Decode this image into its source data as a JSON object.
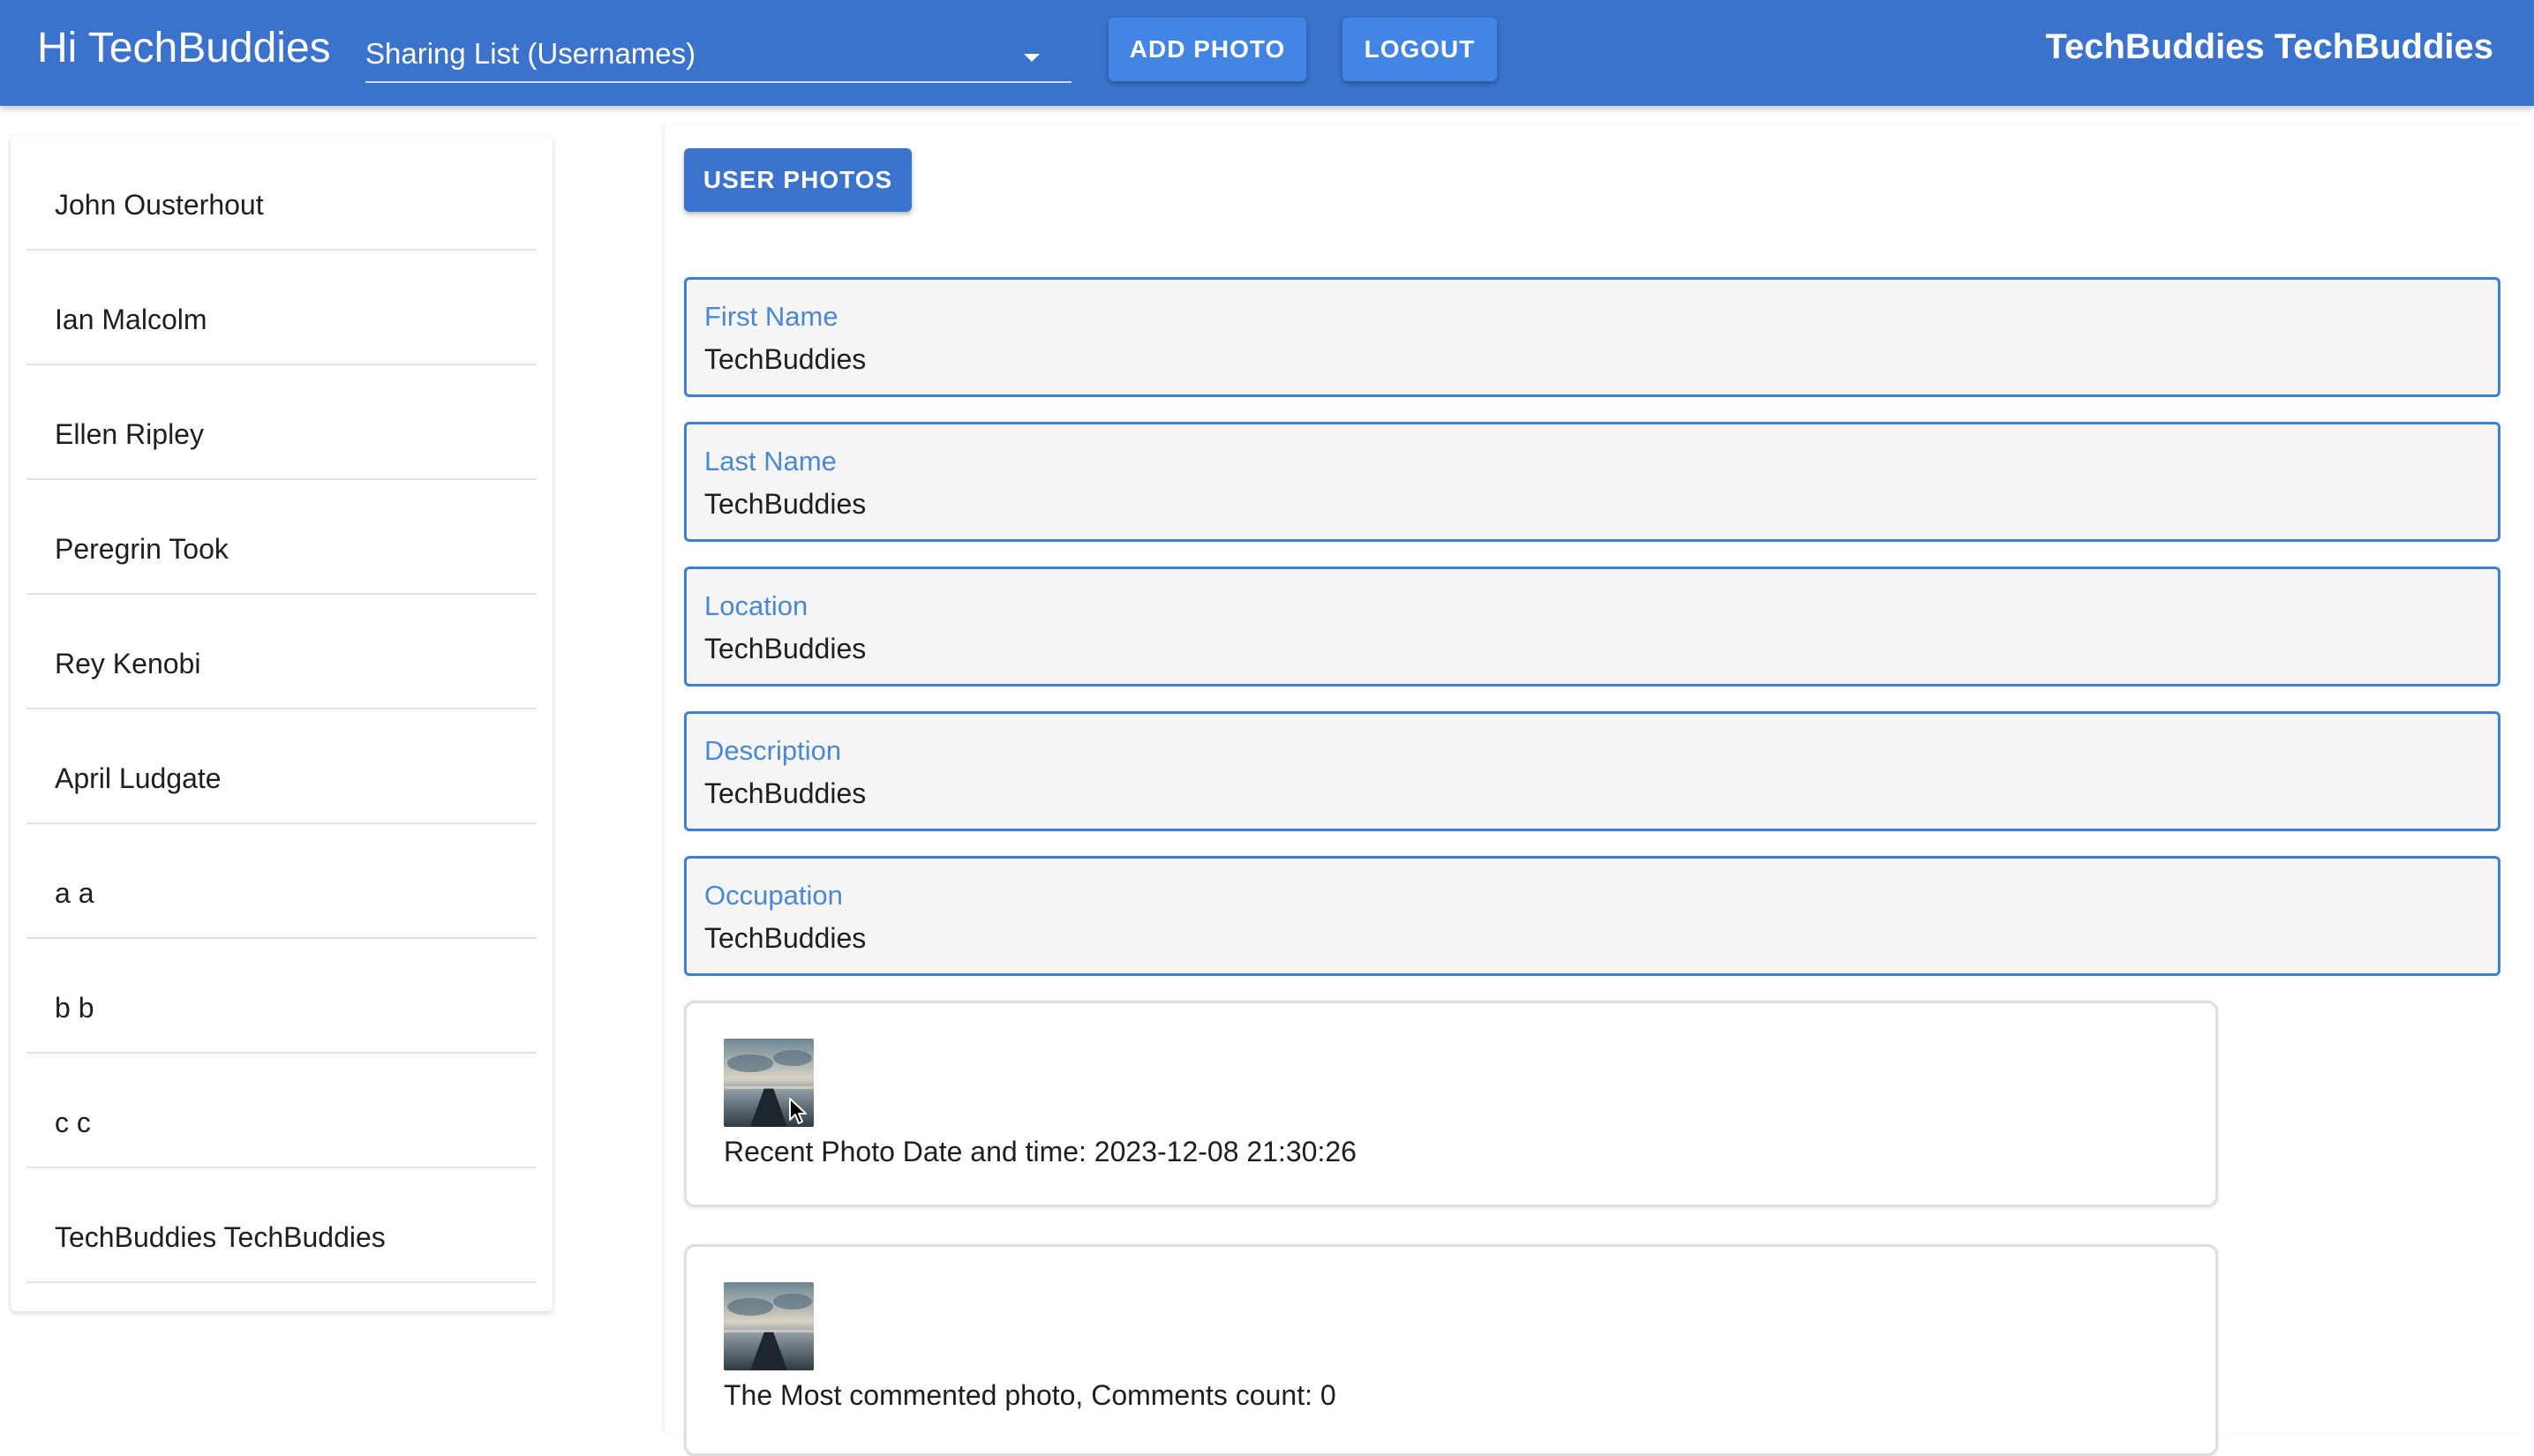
{
  "header": {
    "greeting": "Hi TechBuddies",
    "sharing_list_label": "Sharing List (Usernames)",
    "add_photo_label": "ADD PHOTO",
    "logout_label": "LOGOUT",
    "logged_in_user": "TechBuddies TechBuddies"
  },
  "sidebar": {
    "users": [
      {
        "name": "John Ousterhout"
      },
      {
        "name": "Ian Malcolm"
      },
      {
        "name": "Ellen Ripley"
      },
      {
        "name": "Peregrin Took"
      },
      {
        "name": "Rey Kenobi"
      },
      {
        "name": "April Ludgate"
      },
      {
        "name": "a a"
      },
      {
        "name": "b b"
      },
      {
        "name": "c c"
      },
      {
        "name": "TechBuddies TechBuddies"
      }
    ]
  },
  "main": {
    "user_photos_label": "USER PHOTOS",
    "fields": [
      {
        "label": "First Name",
        "value": "TechBuddies"
      },
      {
        "label": "Last Name",
        "value": "TechBuddies"
      },
      {
        "label": "Location",
        "value": "TechBuddies"
      },
      {
        "label": "Description",
        "value": "TechBuddies"
      },
      {
        "label": "Occupation",
        "value": "TechBuddies"
      }
    ],
    "recent_photo": {
      "caption": "Recent Photo Date and time: 2023-12-08 21:30:26"
    },
    "most_commented_photo": {
      "caption": "The Most commented photo, Comments count: 0"
    }
  },
  "colors": {
    "app_bar": "#3a72cc",
    "button": "#4285e4",
    "field_border": "#3f7fd8",
    "field_label": "#4a88d6"
  },
  "icons": {
    "dropdown": "chevron-down-icon",
    "cursor": "mouse-pointer-icon"
  }
}
